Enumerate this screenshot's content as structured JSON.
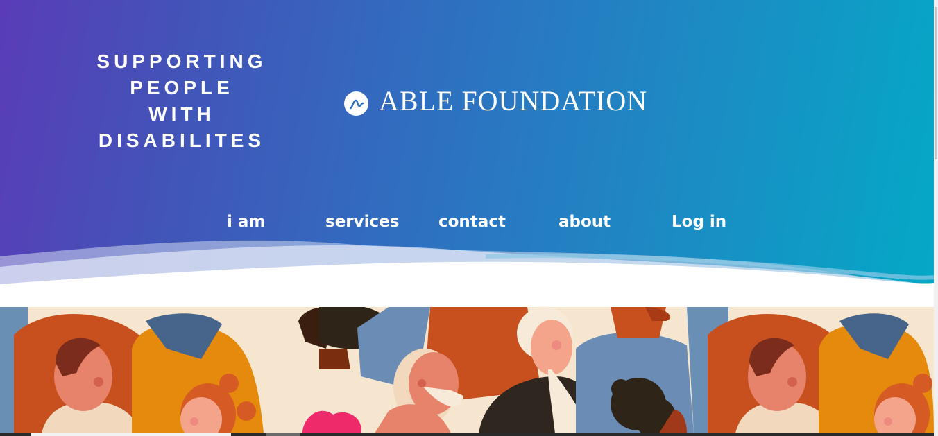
{
  "hero": {
    "tagline": [
      "SUPPORTING",
      "PEOPLE",
      "WITH",
      "DISABILITES"
    ],
    "brand_name": "ABLE FOUNDATION",
    "brand_icon": "wave-logo-icon"
  },
  "nav": {
    "items": [
      {
        "label": "i am"
      },
      {
        "label": "services"
      },
      {
        "label": "contact"
      },
      {
        "label": "about"
      },
      {
        "label": "Log in"
      }
    ]
  },
  "illustration": {
    "icon": "diverse-people-illustration"
  },
  "colors": {
    "gradient_start": "#5a3cb8",
    "gradient_end": "#04a9c6",
    "text": "#ffffff"
  }
}
